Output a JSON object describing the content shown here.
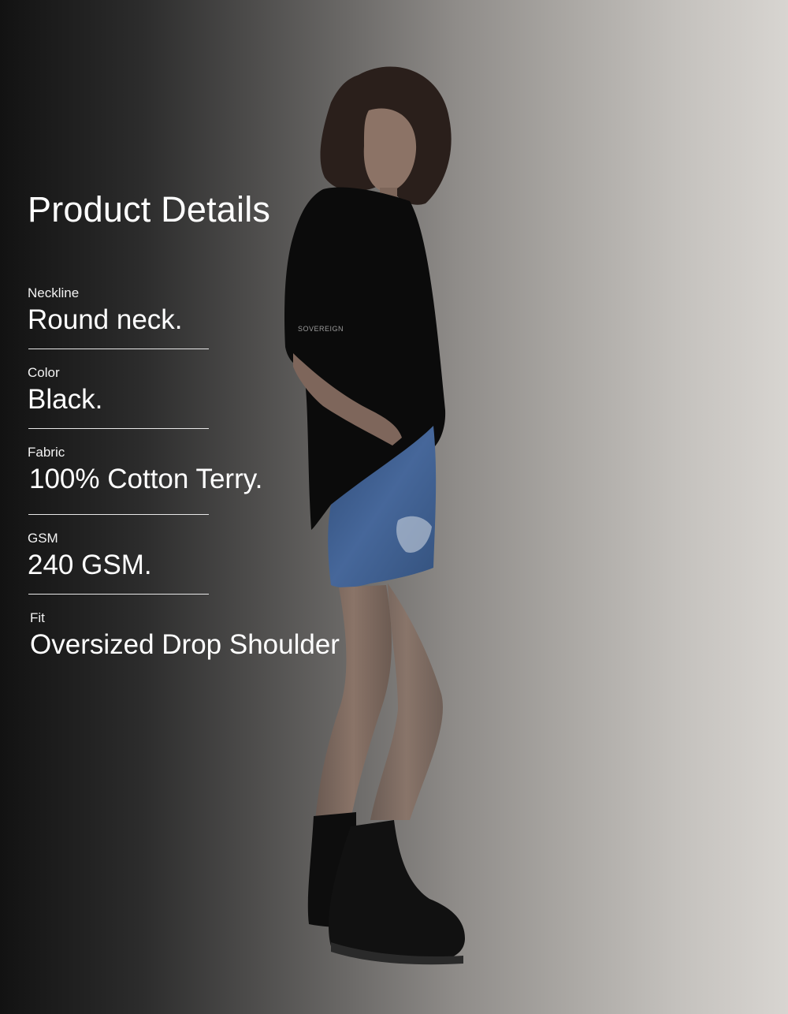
{
  "panel": {
    "title": "Product Details",
    "details": [
      {
        "label": "Neckline",
        "value": "Round neck."
      },
      {
        "label": "Color",
        "value": "Black."
      },
      {
        "label": "Fabric",
        "value": "100% Cotton Terry."
      },
      {
        "label": "GSM",
        "value": "240 GSM."
      },
      {
        "label": "Fit",
        "value": "Oversized Drop Shoulder"
      }
    ]
  },
  "photo": {
    "shirt_print": "SOVEREIGN",
    "background_dark": "#121212",
    "background_light": "#d8d5d1",
    "shirt_color": "#0b0b0b",
    "denim_color": "#3f5f8c"
  }
}
